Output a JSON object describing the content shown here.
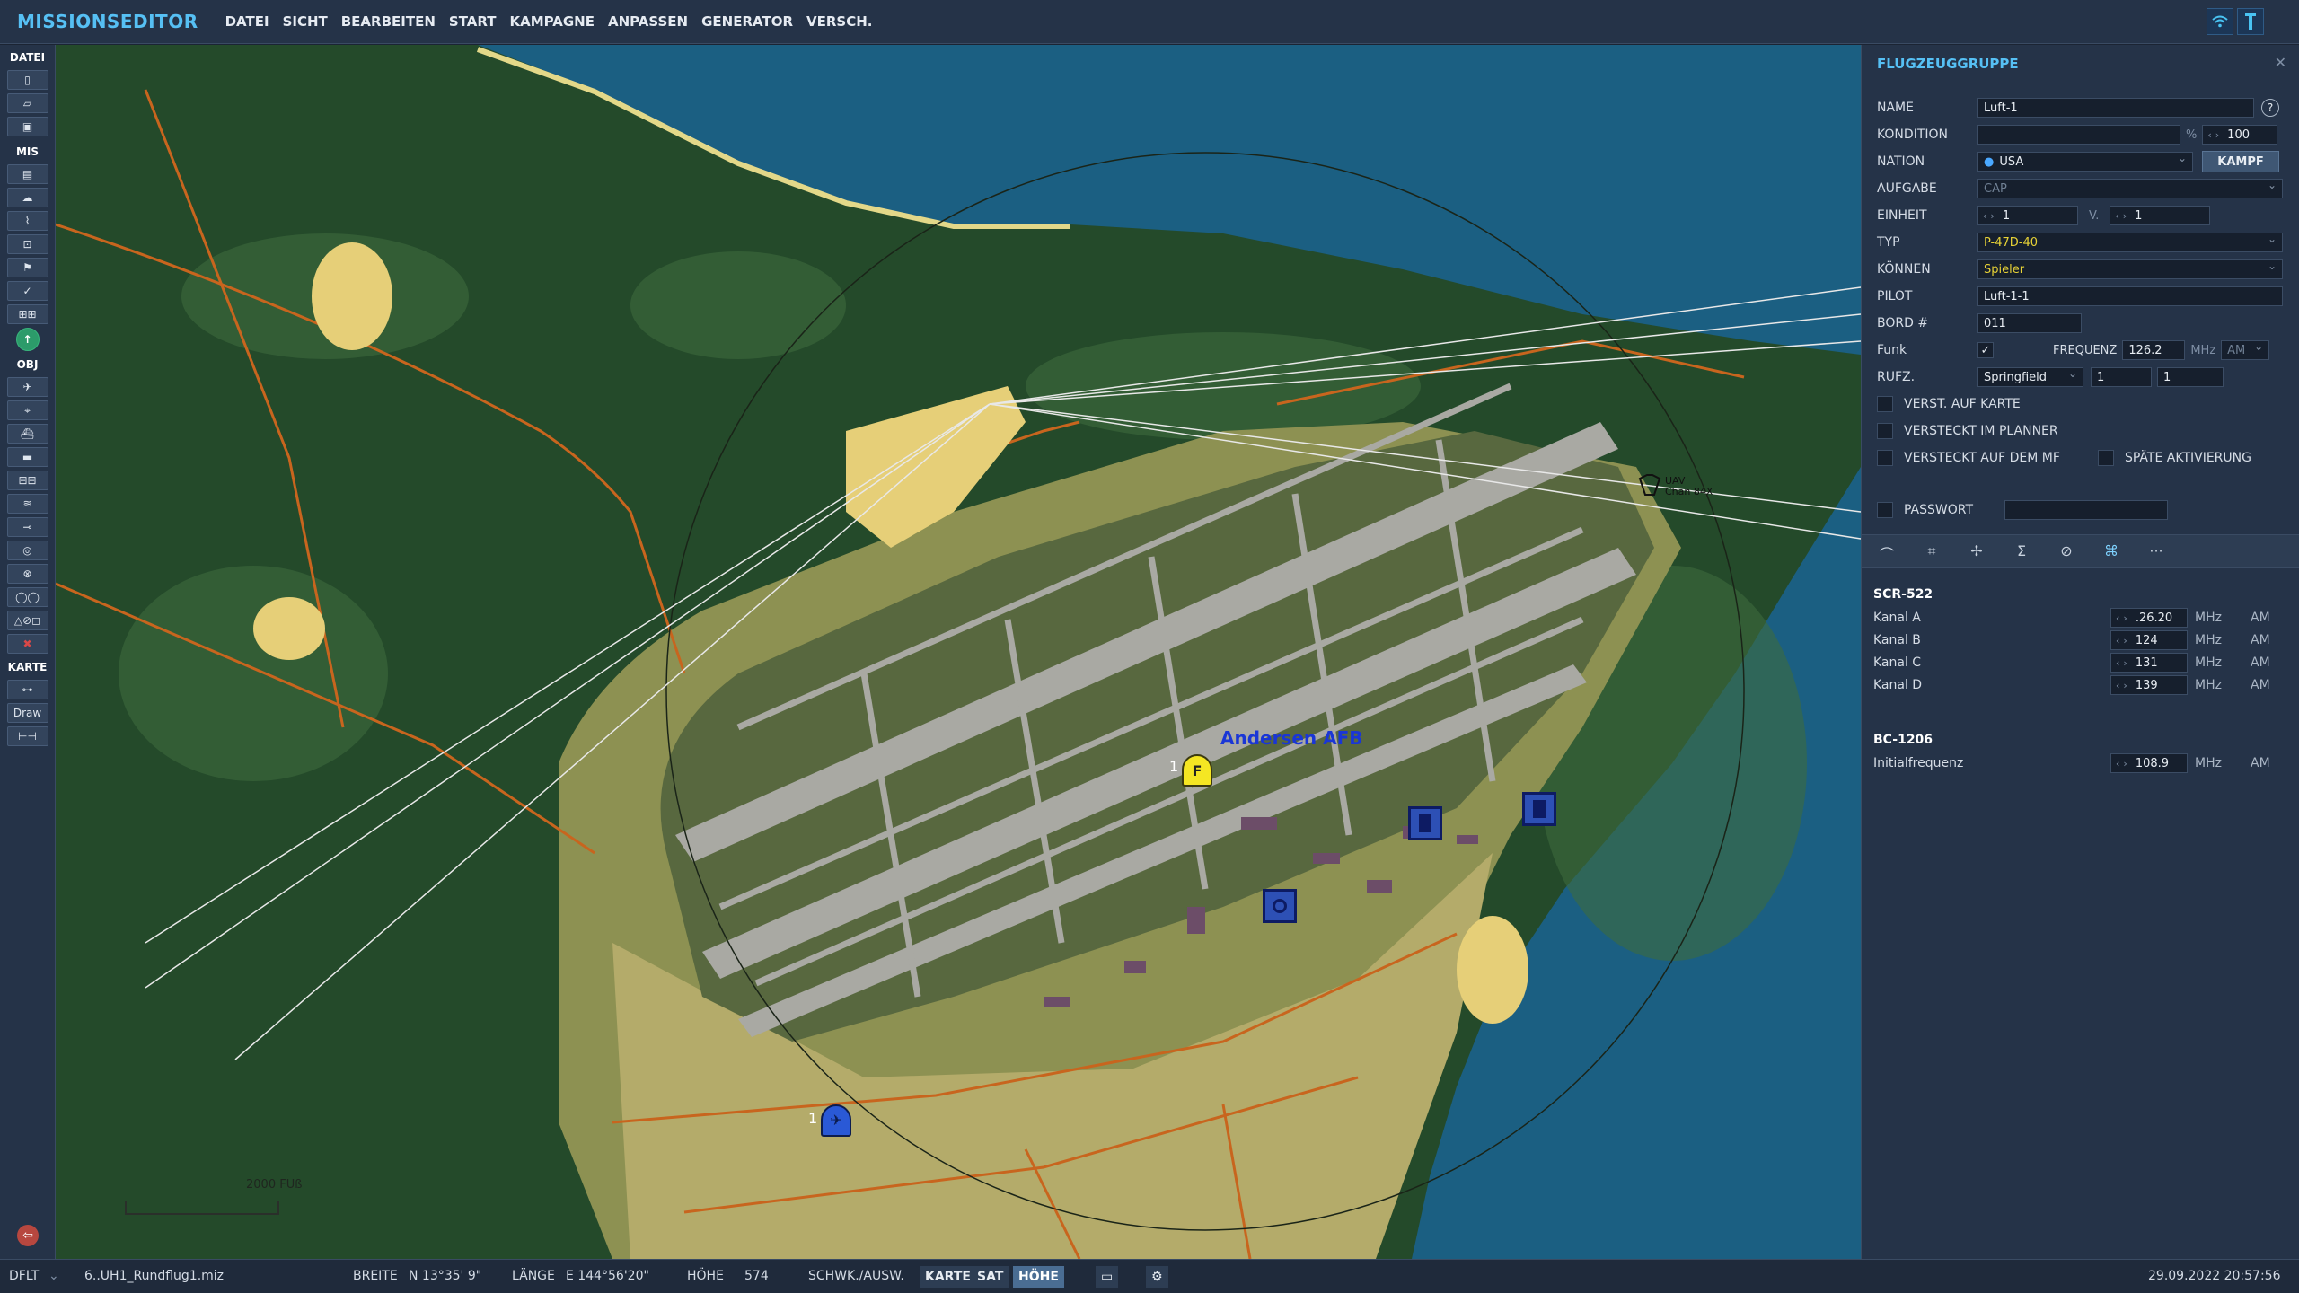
{
  "app": {
    "title": "MISSIONSEDITOR"
  },
  "menu": [
    "DATEI",
    "SICHT",
    "BEARBEITEN",
    "START",
    "KAMPAGNE",
    "ANPASSEN",
    "GENERATOR",
    "VERSCH."
  ],
  "toolbar": {
    "sections": {
      "datei": "DATEI",
      "mis": "MIS",
      "obj": "OBJ",
      "karte": "KARTE"
    },
    "draw_label": "Draw"
  },
  "map": {
    "airfield_label": "Andersen AFB",
    "group_number_1": "1",
    "group_number_2": "1",
    "marker_f": "F",
    "scale_label": "2000 FUß",
    "uav_label_1": "UAV",
    "uav_label_2": "Chan 84X"
  },
  "panel": {
    "title": "FLUGZEUGGRUPPE",
    "help": "?",
    "labels": {
      "name": "NAME",
      "kondition": "KONDITION",
      "nation": "NATION",
      "aufgabe": "AUFGABE",
      "einheit": "EINHEIT",
      "typ": "TYP",
      "koennen": "KÖNNEN",
      "pilot": "PILOT",
      "bord": "BORD #",
      "funk": "Funk",
      "frequenz": "FREQUENZ",
      "rufz": "RUFZ.",
      "v": "V.",
      "verst_karte": "VERST. AUF KARTE",
      "versteckt_planner": "VERSTECKT IM PLANNER",
      "versteckt_mf": "VERSTECKT AUF DEM MF",
      "spaete": "SPÄTE AKTIVIERUNG",
      "passwort": "PASSWORT",
      "percent": "%",
      "mhz": "MHz"
    },
    "values": {
      "name": "Luft-1",
      "kondition": "100",
      "nation": "USA",
      "kampf": "KAMPF",
      "aufgabe": "CAP",
      "einheit": "1",
      "einheit_v": "1",
      "typ": "P-47D-40",
      "koennen": "Spieler",
      "pilot": "Luft-1-1",
      "bord": "011",
      "frequenz": "126.2",
      "modulation": "AM",
      "rufz_name": "Springfield",
      "rufz_1": "1",
      "rufz_2": "1",
      "funk_checked": "✓"
    },
    "radios": {
      "scr_title": "SCR-522",
      "channels": [
        {
          "label": "Kanal A",
          "value": ".26.20",
          "unit": "MHz",
          "mod": "AM"
        },
        {
          "label": "Kanal B",
          "value": "124",
          "unit": "MHz",
          "mod": "AM"
        },
        {
          "label": "Kanal C",
          "value": "131",
          "unit": "MHz",
          "mod": "AM"
        },
        {
          "label": "Kanal D",
          "value": "139",
          "unit": "MHz",
          "mod": "AM"
        }
      ],
      "bc_title": "BC-1206",
      "bc_label": "Initialfrequenz",
      "bc_value": "108.9",
      "bc_unit": "MHz",
      "bc_mod": "AM"
    }
  },
  "status": {
    "profile": "DFLT",
    "file": "6..UH1_Rundflug1.miz",
    "breite_label": "BREITE",
    "breite": "N 13°35' 9\"",
    "laenge_label": "LÄNGE",
    "laenge": "E 144°56'20\"",
    "hoehe_label": "HÖHE",
    "hoehe": "574",
    "schwk_label": "SCHWK./AUSW.",
    "btn_karte": "KARTE",
    "btn_sat": "SAT",
    "btn_hoehe": "HÖHE",
    "datetime": "29.09.2022 20:57:56"
  },
  "colors": {
    "accent": "#56c0f4",
    "sea": "#1b5f82",
    "forest": "#244a2a",
    "airfield_grass": "#58683f",
    "runway": "#a9a9a3",
    "roads": "#c8651e"
  }
}
